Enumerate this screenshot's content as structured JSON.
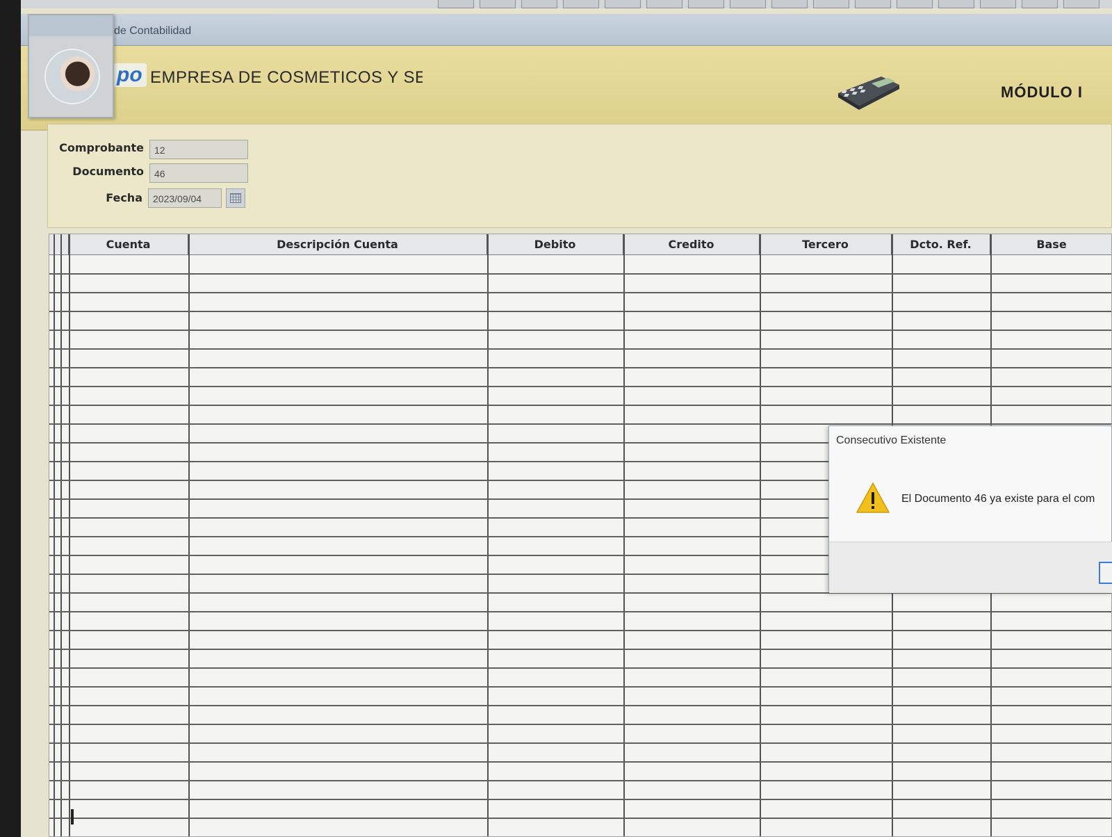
{
  "window": {
    "title": "de Contabilidad"
  },
  "header": {
    "logo": "po",
    "company": "EMPRESA DE COSMETICOS Y SEI",
    "module": "MÓDULO I",
    "calculator_icon": "calculator-icon"
  },
  "form": {
    "comprobante": {
      "label": "Comprobante",
      "value": "12"
    },
    "documento": {
      "label": "Documento",
      "value": "46"
    },
    "fecha": {
      "label": "Fecha",
      "value": "2023/09/04",
      "icon": "calendar-icon"
    }
  },
  "table": {
    "columns": [
      "Cuenta",
      "Descripción Cuenta",
      "Debito",
      "Credito",
      "Tercero",
      "Dcto. Ref.",
      "Base"
    ]
  },
  "dialog": {
    "title": "Consecutivo Existente",
    "message": "El Documento 46 ya existe para el com",
    "icon": "warning-icon",
    "accent": "#3a7bd5"
  },
  "colors": {
    "header_band": "#e3d794",
    "form_bg": "#ece7c9",
    "warning": "#f2c01c"
  }
}
